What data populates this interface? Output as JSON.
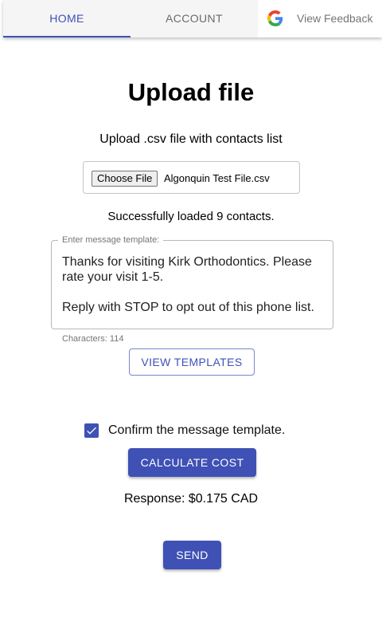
{
  "tabs": {
    "home": "HOME",
    "account": "ACCOUNT"
  },
  "feedback": {
    "label": "View Feedback",
    "icon": "google-g-icon"
  },
  "page": {
    "title": "Upload file",
    "subtitle": "Upload .csv file with contacts list"
  },
  "file_input": {
    "button_label": "Choose File",
    "file_name": "Algonquin Test File.csv"
  },
  "status": "Successfully loaded 9 contacts.",
  "template": {
    "legend": "Enter message template:",
    "value": "Thanks for visiting Kirk Orthodontics. Please rate your visit 1-5.\n\nReply with STOP to opt out of this phone list.",
    "char_count": "Characters: 114"
  },
  "buttons": {
    "view_templates": "VIEW TEMPLATES",
    "calculate_cost": "CALCULATE COST",
    "send": "SEND"
  },
  "confirm": {
    "label": "Confirm the message template.",
    "checked": true
  },
  "response": "Response: $0.175 CAD",
  "colors": {
    "primary": "#3f51b5",
    "tabbar_bg": "#f5f5f5"
  }
}
